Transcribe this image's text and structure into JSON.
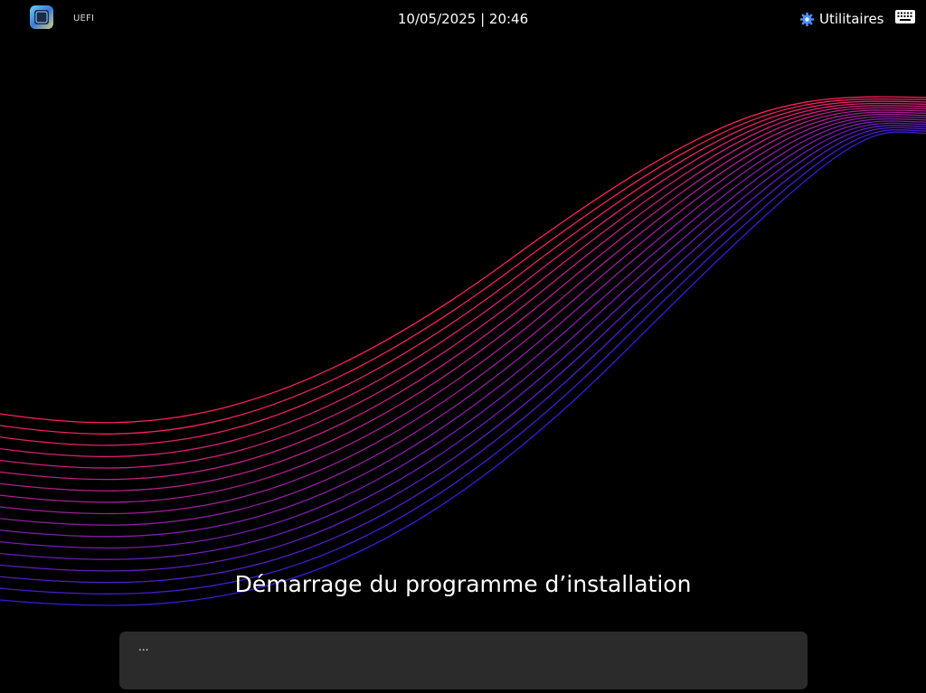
{
  "topbar": {
    "logo_icon": "setup-logo-icon",
    "firmware_mode": "UEFI",
    "datetime": "10/05/2025 | 20:46",
    "utilities": {
      "icon": "gear-icon",
      "label": "Utilitaires"
    },
    "keyboard_icon": "keyboard-icon"
  },
  "main": {
    "status_title": "Démarrage du programme d’installation",
    "log_text": "..."
  },
  "colors": {
    "background": "#000000",
    "wave_start": "#ff1f5a",
    "wave_end": "#3a1bd9",
    "panel": "#2b2b2b",
    "accent_blue": "#4a8ef0"
  }
}
